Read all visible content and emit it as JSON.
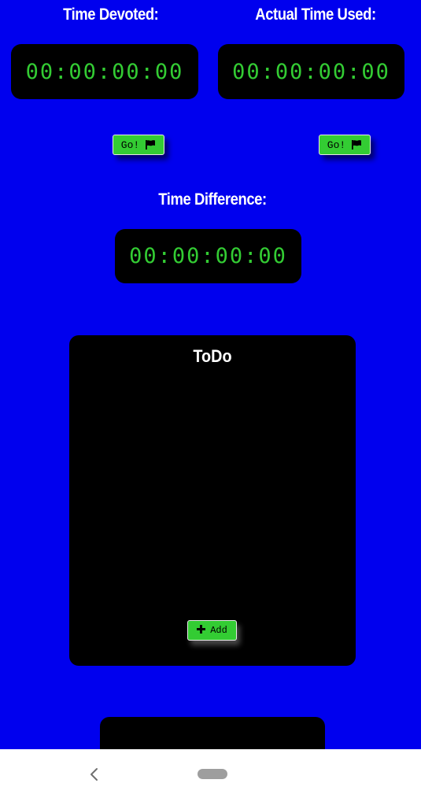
{
  "labels": {
    "time_devoted": "Time Devoted:",
    "actual_time_used": "Actual Time Used:",
    "time_difference": "Time Difference:"
  },
  "timers": {
    "devoted": "00:00:00:00",
    "actual": "00:00:00:00",
    "difference": "00:00:00:00"
  },
  "buttons": {
    "go_devoted": "Go!",
    "go_actual": "Go!",
    "add": "Add"
  },
  "todo": {
    "title": "ToDo",
    "items": []
  },
  "icons": {
    "go": "flag-icon",
    "add": "plus-icon",
    "nav_back": "chevron-left-icon",
    "nav_home": "home-pill-icon"
  },
  "colors": {
    "background": "#0000ee",
    "panel": "#000000",
    "timer_digits": "#33cc33",
    "button": "#33cc33",
    "label_text": "#ffffff"
  }
}
